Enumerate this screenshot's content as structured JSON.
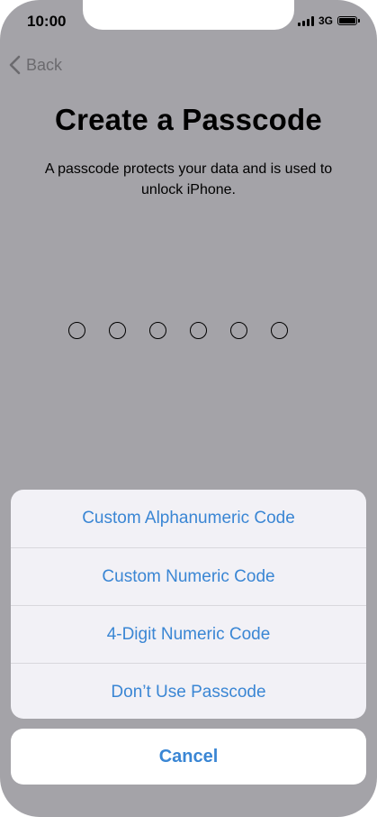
{
  "status_bar": {
    "time": "10:00",
    "network": "3G",
    "icons": [
      "signal-icon",
      "battery-icon"
    ]
  },
  "nav": {
    "back_label": "Back",
    "back_icon": "chevron-left-icon"
  },
  "header": {
    "title": "Create a Passcode",
    "subtitle": "A passcode protects your data and is used to unlock iPhone."
  },
  "passcode": {
    "digits": 6,
    "entered": 0
  },
  "action_sheet": {
    "options": [
      {
        "label": "Custom Alphanumeric Code"
      },
      {
        "label": "Custom Numeric Code"
      },
      {
        "label": "4-Digit Numeric Code"
      },
      {
        "label": "Don’t Use Passcode"
      }
    ],
    "cancel_label": "Cancel"
  },
  "colors": {
    "dimmed_background": "#a4a3a8",
    "accent": "#3a86d4",
    "sheet_background": "#f2f1f6"
  }
}
